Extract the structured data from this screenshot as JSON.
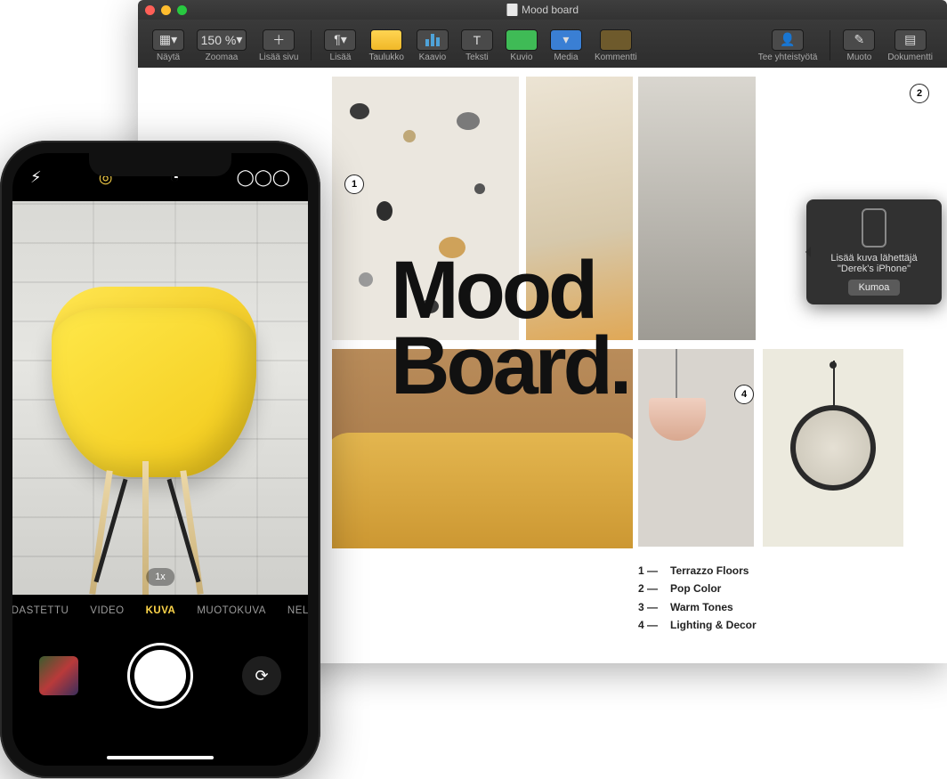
{
  "macWindow": {
    "title": "Mood board",
    "toolbar": {
      "view": "Näytä",
      "zoom": "Zoomaa",
      "zoomValue": "150 %",
      "addPage": "Lisää sivu",
      "insert": "Lisää",
      "table": "Taulukko",
      "chart": "Kaavio",
      "text": "Teksti",
      "shape": "Kuvio",
      "media": "Media",
      "comment": "Kommentti",
      "collaborate": "Tee yhteistyötä",
      "format": "Muoto",
      "document": "Dokumentti"
    },
    "document": {
      "heading": "Mood\nBoard.",
      "badges": {
        "n1": "1",
        "n2": "2",
        "n4": "4"
      },
      "legend": [
        {
          "num": "1 —",
          "label": "Terrazzo Floors"
        },
        {
          "num": "2 —",
          "label": "Pop Color"
        },
        {
          "num": "3 —",
          "label": "Warm Tones"
        },
        {
          "num": "4 —",
          "label": "Lighting & Decor"
        }
      ]
    },
    "popover": {
      "line1": "Lisää kuva lähettäjä",
      "line2": "\"Derek's iPhone\"",
      "button": "Kumoa"
    }
  },
  "iphone": {
    "zoom": "1x",
    "modes": {
      "slomo": "HIDASTETTU",
      "video": "VIDEO",
      "photo": "KUVA",
      "portrait": "MUOTOKUVA",
      "pano": "NELIÖ"
    }
  }
}
